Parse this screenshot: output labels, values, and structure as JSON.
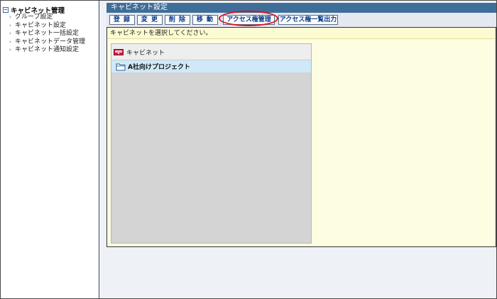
{
  "sidebar": {
    "title": "キャビネット管理",
    "items": [
      {
        "label": "グループ設定"
      },
      {
        "label": "キャビネット設定"
      },
      {
        "label": "キャビネット一括設定"
      },
      {
        "label": "キャビネットデータ管理"
      },
      {
        "label": "キャビネット通知設定"
      }
    ]
  },
  "main": {
    "title": "キャビネット設定",
    "toolbar": {
      "register": "登 録",
      "change": "変 更",
      "delete": "削 除",
      "move": "移 動",
      "access_manage": "アクセス権管理",
      "access_list_output": "アクセス権一覧出力"
    },
    "hint": "キャビネットを選択してください。",
    "tree": {
      "root_label": "キャビネット",
      "items": [
        {
          "label": "A社向けプロジェクト"
        }
      ]
    }
  },
  "colors": {
    "title_bar": "#3f6e98",
    "highlight_ring": "#d8111a",
    "selected_row": "#cfe9f8",
    "content_bg": "#fdfde2"
  }
}
